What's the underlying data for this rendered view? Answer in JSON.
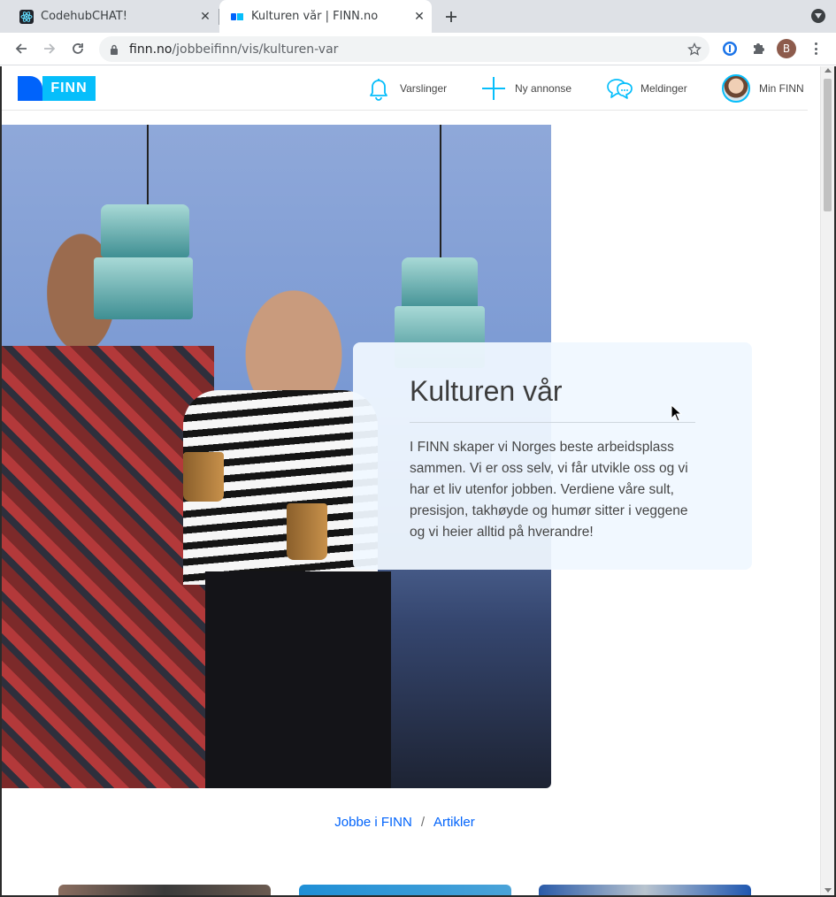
{
  "browser": {
    "tabs": [
      {
        "title": "CodehubCHAT!",
        "active": false,
        "favicon": "react-atom-icon"
      },
      {
        "title": "Kulturen vår | FINN.no",
        "active": true,
        "favicon": "finn-favicon-icon"
      }
    ],
    "url_domain": "finn.no",
    "url_path": "/jobbeifinn/vis/kulturen-var",
    "profile_initial": "B"
  },
  "header": {
    "nav": [
      {
        "label": "Varslinger",
        "icon": "bell-icon"
      },
      {
        "label": "Ny annonse",
        "icon": "plus-icon"
      },
      {
        "label": "Meldinger",
        "icon": "chat-bubbles-icon"
      },
      {
        "label": "Min FINN",
        "icon": "avatar"
      }
    ],
    "logo_text": "FINN"
  },
  "hero": {
    "title": "Kulturen vår",
    "text": "I FINN skaper vi Norges beste arbeidsplass sammen. Vi er oss selv, vi får utvikle oss og vi har et liv utenfor jobben. Verdiene våre sult, presisjon, takhøyde og humør sitter i veggene og vi heier alltid på hverandre!"
  },
  "breadcrumb": {
    "items": [
      "Jobbe i FINN",
      "Artikler"
    ],
    "separator": "/"
  },
  "colors": {
    "finn_blue": "#0063fb",
    "finn_light_blue": "#06befb",
    "link": "#0063fb"
  }
}
